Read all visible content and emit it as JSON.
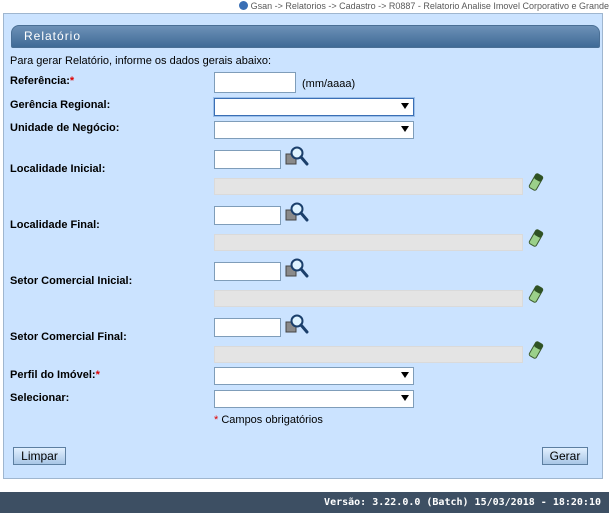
{
  "breadcrumb": {
    "text": "Gsan -> Relatorios -> Cadastro -> R0887 - Relatorio Analise Imovel Corporativo e Grande"
  },
  "panel": {
    "title": "Relatório"
  },
  "intro": "Para gerar Relatório, informe os dados gerais abaixo:",
  "fields": {
    "referencia": {
      "label": "Referência:",
      "required_mark": "*",
      "value": "",
      "hint": "(mm/aaaa)"
    },
    "gerencia": {
      "label": "Gerência Regional:",
      "selected": ""
    },
    "unidade": {
      "label": "Unidade de Negócio:",
      "selected": ""
    },
    "localidade_inicial": {
      "label": "Localidade Inicial:",
      "value": "",
      "description": ""
    },
    "localidade_final": {
      "label": "Localidade Final:",
      "value": "",
      "description": ""
    },
    "setor_inicial": {
      "label": "Setor Comercial Inicial:",
      "value": "",
      "description": ""
    },
    "setor_final": {
      "label": "Setor Comercial Final:",
      "value": "",
      "description": ""
    },
    "perfil": {
      "label": "Perfil do Imóvel:",
      "required_mark": "*",
      "selected": ""
    },
    "selecionar": {
      "label": "Selecionar:",
      "selected": ""
    }
  },
  "required_note": {
    "mark": "*",
    "text": "Campos obrigatórios"
  },
  "buttons": {
    "limpar": "Limpar",
    "gerar": "Gerar"
  },
  "footer": {
    "version": "Versão: 3.22.0.0 (Batch) 15/03/2018 - 18:20:10"
  },
  "colors": {
    "panel_bg": "#cbe3ff",
    "title_bar": "#4f779f",
    "footer_bg": "#3d4f63",
    "required": "#e00000"
  },
  "icons": {
    "search": "magnifier-icon",
    "clear": "eraser-icon",
    "breadcrumb": "globe-icon"
  }
}
